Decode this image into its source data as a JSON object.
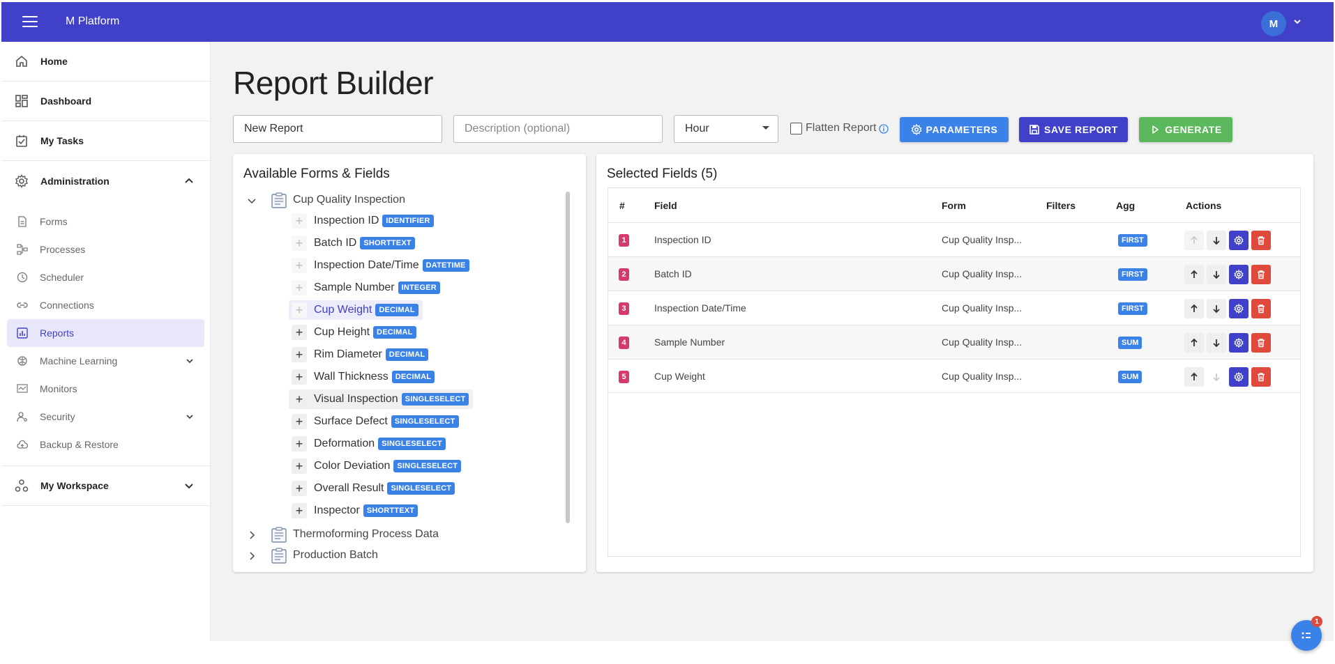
{
  "app": {
    "title": "M Platform",
    "user_initial": "M"
  },
  "sidebar": {
    "main_items": [
      {
        "label": "Home",
        "icon": "home-icon"
      },
      {
        "label": "Dashboard",
        "icon": "dashboard-icon"
      },
      {
        "label": "My Tasks",
        "icon": "tasks-icon"
      },
      {
        "label": "Administration",
        "icon": "gear-icon"
      }
    ],
    "admin_items": [
      {
        "label": "Forms",
        "icon": "document-icon"
      },
      {
        "label": "Processes",
        "icon": "process-icon"
      },
      {
        "label": "Scheduler",
        "icon": "clock-icon"
      },
      {
        "label": "Connections",
        "icon": "link-icon"
      },
      {
        "label": "Reports",
        "icon": "chart-icon",
        "active": true
      },
      {
        "label": "Machine Learning",
        "icon": "brain-icon"
      },
      {
        "label": "Monitors",
        "icon": "monitor-icon"
      },
      {
        "label": "Security",
        "icon": "user-key-icon"
      },
      {
        "label": "Backup & Restore",
        "icon": "cloud-icon"
      }
    ],
    "workspace_label": "My Workspace"
  },
  "page": {
    "title": "Report Builder",
    "report_name": "New Report",
    "description_placeholder": "Description (optional)",
    "interval_value": "Hour",
    "flatten_label": "Flatten Report",
    "parameters_label": "PARAMETERS",
    "save_label": "SAVE REPORT",
    "generate_label": "GENERATE"
  },
  "available": {
    "title": "Available Forms & Fields",
    "forms": [
      {
        "name": "Cup Quality Inspection",
        "expanded": true
      },
      {
        "name": "Thermoforming Process Data",
        "expanded": false
      },
      {
        "name": "Production Batch",
        "expanded": false
      }
    ],
    "fields": [
      {
        "name": "Inspection ID",
        "type": "IDENTIFIER"
      },
      {
        "name": "Batch ID",
        "type": "SHORTTEXT"
      },
      {
        "name": "Inspection Date/Time",
        "type": "DATETIME"
      },
      {
        "name": "Sample Number",
        "type": "INTEGER"
      },
      {
        "name": "Cup Weight",
        "type": "DECIMAL"
      },
      {
        "name": "Cup Height",
        "type": "DECIMAL"
      },
      {
        "name": "Rim Diameter",
        "type": "DECIMAL"
      },
      {
        "name": "Wall Thickness",
        "type": "DECIMAL"
      },
      {
        "name": "Visual Inspection",
        "type": "SINGLESELECT"
      },
      {
        "name": "Surface Defect",
        "type": "SINGLESELECT"
      },
      {
        "name": "Deformation",
        "type": "SINGLESELECT"
      },
      {
        "name": "Color Deviation",
        "type": "SINGLESELECT"
      },
      {
        "name": "Overall Result",
        "type": "SINGLESELECT"
      },
      {
        "name": "Inspector",
        "type": "SHORTTEXT"
      }
    ]
  },
  "selected": {
    "title": "Selected Fields (5)",
    "headers": {
      "num": "#",
      "field": "Field",
      "form": "Form",
      "filters": "Filters",
      "agg": "Agg",
      "actions": "Actions"
    },
    "rows": [
      {
        "num": "1",
        "field": "Inspection ID",
        "form": "Cup Quality Insp...",
        "agg": "FIRST"
      },
      {
        "num": "2",
        "field": "Batch ID",
        "form": "Cup Quality Insp...",
        "agg": "FIRST"
      },
      {
        "num": "3",
        "field": "Inspection Date/Time",
        "form": "Cup Quality Insp...",
        "agg": "FIRST"
      },
      {
        "num": "4",
        "field": "Sample Number",
        "form": "Cup Quality Insp...",
        "agg": "SUM"
      },
      {
        "num": "5",
        "field": "Cup Weight",
        "form": "Cup Quality Insp...",
        "agg": "SUM"
      }
    ]
  },
  "fab_badge": "1",
  "colors": {
    "primary": "#4040c8",
    "accent": "#3b82e8",
    "success": "#5cb85c",
    "danger": "#e04a3c",
    "index": "#d63a6a"
  }
}
